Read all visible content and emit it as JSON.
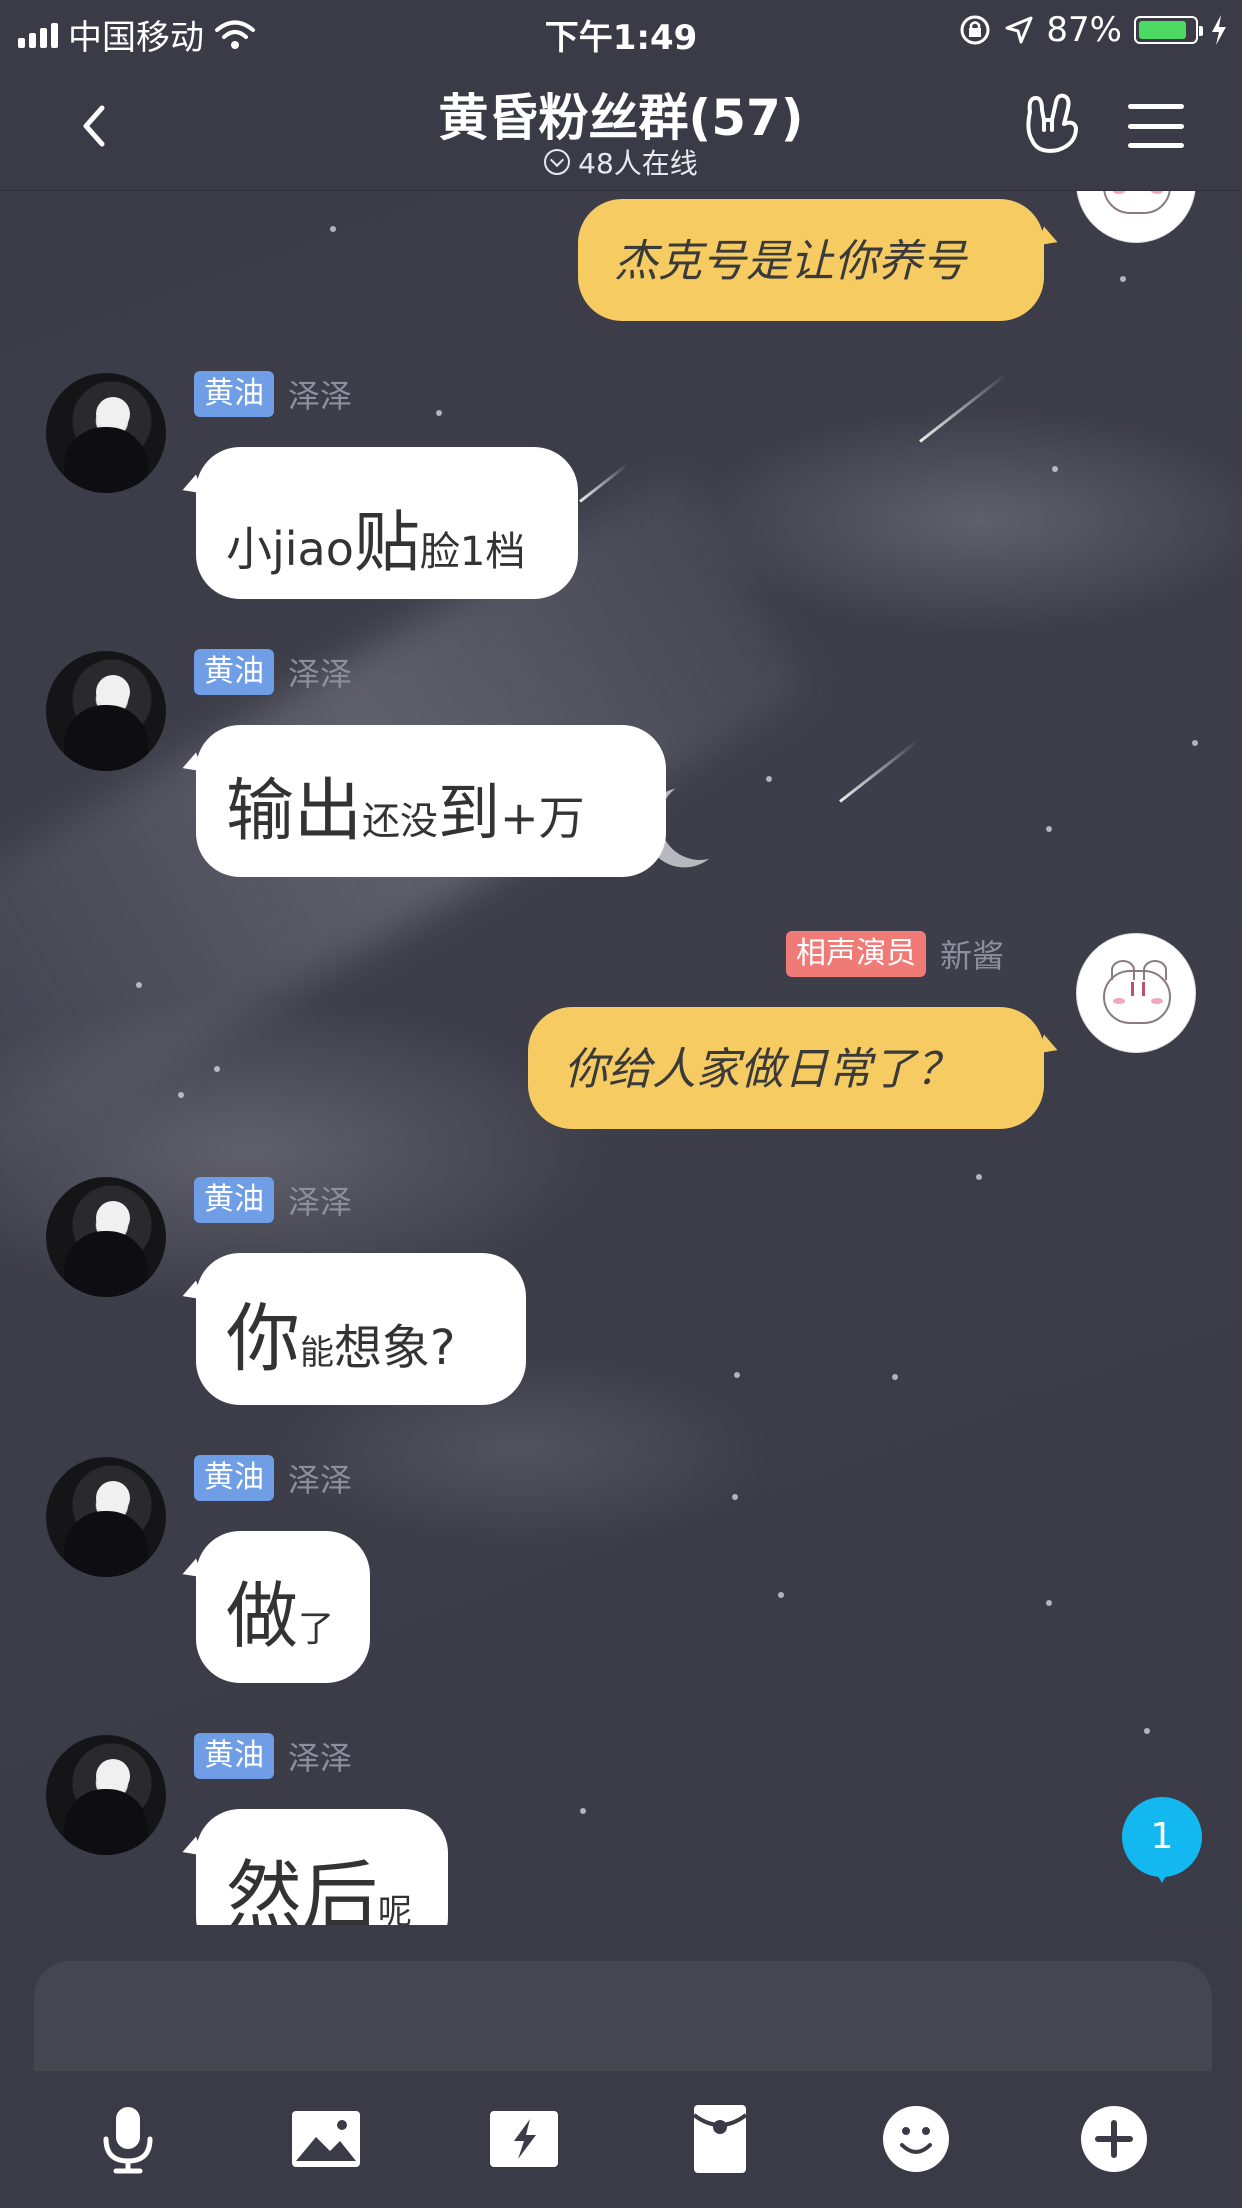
{
  "status_bar": {
    "carrier": "中国移动",
    "time": "下午1:49",
    "battery_percent": "87%",
    "battery_level": 0.87,
    "battery_color": "#4cd964"
  },
  "header": {
    "title": "黄昏粉丝群(57)",
    "online": "48人在线",
    "back_icon": "chevron-left-icon",
    "rock_icon": "rock-hand-icon",
    "menu_icon": "hamburger-menu-icon"
  },
  "messages": [
    {
      "side": "right",
      "badge": "",
      "sender": "",
      "segments": [
        {
          "text": "杰克号是让你养号",
          "size": 44
        }
      ]
    },
    {
      "side": "left",
      "badge": "黄油",
      "sender": "泽泽",
      "segments": [
        {
          "text": "小jiao",
          "size": 46
        },
        {
          "text": "贴",
          "size": 66
        },
        {
          "text": "脸1档",
          "size": 40
        }
      ]
    },
    {
      "side": "left",
      "badge": "黄油",
      "sender": "泽泽",
      "segments": [
        {
          "text": "输出",
          "size": 68
        },
        {
          "text": "还没",
          "size": 38
        },
        {
          "text": "到",
          "size": 62
        },
        {
          "text": "+万",
          "size": 46
        }
      ]
    },
    {
      "side": "right",
      "badge": "相声演员",
      "sender": "新酱",
      "segments": [
        {
          "text": "你给人家做日常了？",
          "size": 44
        }
      ]
    },
    {
      "side": "left",
      "badge": "黄油",
      "sender": "泽泽",
      "segments": [
        {
          "text": "你",
          "size": 74
        },
        {
          "text": "能",
          "size": 34
        },
        {
          "text": "想象?",
          "size": 48
        }
      ]
    },
    {
      "side": "left",
      "badge": "黄油",
      "sender": "泽泽",
      "segments": [
        {
          "text": "做",
          "size": 72
        },
        {
          "text": "了",
          "size": 36
        }
      ]
    },
    {
      "side": "left",
      "badge": "黄油",
      "sender": "泽泽",
      "segments": [
        {
          "text": "然后",
          "size": 76
        },
        {
          "text": "呢",
          "size": 34
        }
      ]
    }
  ],
  "unread_count": "1",
  "toolbar": [
    {
      "name": "microphone-icon"
    },
    {
      "name": "image-icon"
    },
    {
      "name": "flash-photo-icon"
    },
    {
      "name": "red-packet-icon"
    },
    {
      "name": "emoji-icon"
    },
    {
      "name": "plus-icon"
    }
  ],
  "colors": {
    "background": "#3b3c48",
    "bubble_left": "#ffffff",
    "bubble_right": "#f6cc62",
    "badge_blue": "#6f9ee6",
    "badge_red": "#f07a76",
    "unread": "#14b8f0"
  }
}
